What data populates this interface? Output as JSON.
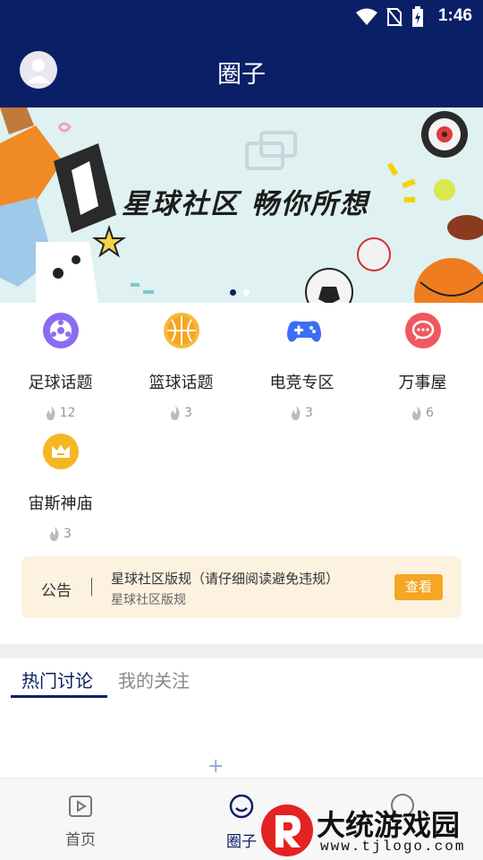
{
  "status_bar": {
    "time": "1:46"
  },
  "header": {
    "title": "圈子"
  },
  "banner": {
    "slogan": "星球社区 畅你所想",
    "dots": 2,
    "active_dot": 0
  },
  "categories": [
    {
      "name": "足球话题",
      "heat": "12",
      "color": "#8b6cf0",
      "icon": "football-icon"
    },
    {
      "name": "篮球话题",
      "heat": "3",
      "color": "#f6b93b",
      "icon": "basketball-icon"
    },
    {
      "name": "电竞专区",
      "heat": "3",
      "color": "#3b6ef6",
      "icon": "gamepad-icon"
    },
    {
      "name": "万事屋",
      "heat": "6",
      "color": "#f0585f",
      "icon": "chat-bubble-icon"
    },
    {
      "name": "宙斯神庙",
      "heat": "3",
      "color": "#f5b623",
      "icon": "crown-icon"
    }
  ],
  "notice": {
    "label": "公告",
    "line1": "星球社区版规（请仔细阅读避免违规）",
    "line2": "星球社区版规",
    "button": "查看"
  },
  "tabs": {
    "active": "热门讨论",
    "inactive": "我的关注"
  },
  "bottom_nav": [
    {
      "label": "首页",
      "icon": "play-square-icon"
    },
    {
      "label": "圈子",
      "icon": "smile-bubble-icon"
    }
  ],
  "watermark": {
    "brand": "大统游戏园",
    "url": "www.tjlogo.com"
  },
  "colors": {
    "primary": "#0a1f66",
    "notice_bg": "#fdf2e0",
    "notice_button": "#f5a623"
  }
}
